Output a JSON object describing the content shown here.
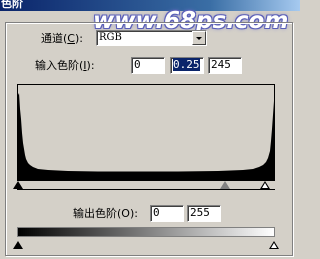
{
  "window": {
    "title": "色阶"
  },
  "watermark": "www.68ps.com",
  "channel": {
    "label_prefix": "通道(",
    "label_key": "C",
    "label_suffix": "):",
    "value": "RGB"
  },
  "input_levels": {
    "label_prefix": "输入色阶(",
    "label_key": "I",
    "label_suffix": "):",
    "black": "0",
    "gamma": "0.25",
    "white": "245"
  },
  "output_levels": {
    "label": "输出色阶(O):",
    "black": "0",
    "white": "255"
  }
}
